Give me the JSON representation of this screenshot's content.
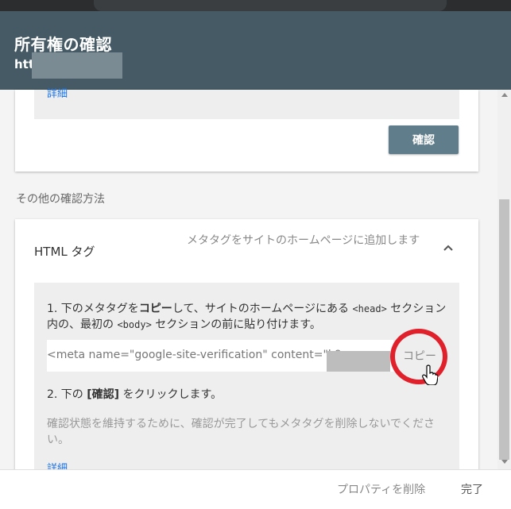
{
  "header": {
    "title": "所有権の確認",
    "url": "htt"
  },
  "card_top": {
    "details_link": "詳細",
    "confirm_button": "確認"
  },
  "section_label": "その他の確認方法",
  "html_tag": {
    "title": "HTML タグ",
    "description": "メタタグをサイトのホームページに追加します",
    "step1_prefix": "1. 下のメタタグを",
    "step1_bold": "コピー",
    "step1_mid": "して、サイトのホームページにある",
    "step1_code1": "<head>",
    "step1_mid2": "セクション内の、最初の",
    "step1_code2": "<body>",
    "step1_suffix": "セクションの前に貼り付けます。",
    "meta_text": "<meta name=\"google-site-verification\" content=\"k9",
    "copy_button": "コピー",
    "step2_prefix": "2. 下の",
    "step2_bold": "[確認]",
    "step2_suffix": "をクリックします。",
    "note": "確認状態を維持するために、確認が完了してもメタタグを削除しないでください。",
    "details_link": "詳細"
  },
  "footer": {
    "remove_button": "プロパティを削除",
    "done_button": "完了"
  },
  "colors": {
    "header_bg": "#455a64",
    "confirm_btn": "#607d8b",
    "highlight_circle": "#e0202a",
    "link": "#1a73e8"
  }
}
